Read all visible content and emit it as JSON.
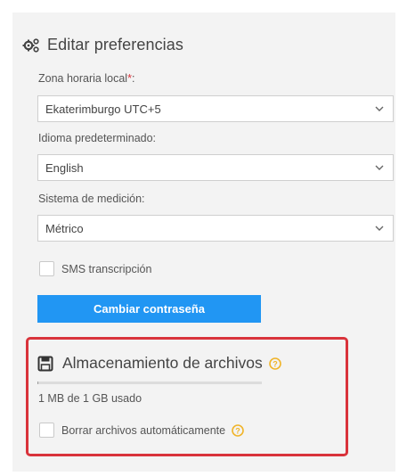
{
  "header": {
    "title": "Editar preferencias",
    "icon": "gears-icon"
  },
  "timezone": {
    "label": "Zona horaria local",
    "required_mark": "*",
    "label_suffix": ":",
    "value": "Ekaterimburgo UTC+5"
  },
  "language": {
    "label": "Idioma predeterminado:",
    "value": "English"
  },
  "measurement": {
    "label": "Sistema de medición:",
    "value": "Métrico"
  },
  "sms": {
    "label": "SMS transcripción",
    "checked": false
  },
  "change_password": {
    "label": "Cambiar contraseña"
  },
  "storage": {
    "title": "Almacenamiento de archivos",
    "icon": "save-icon",
    "usage_text": "1 MB de 1 GB usado",
    "usage_fraction": 0.001,
    "auto_delete_label": "Borrar archivos automáticamente",
    "auto_delete_checked": false
  },
  "colors": {
    "accent": "#2196f3",
    "highlight": "#d9333b",
    "help": "#f0b429"
  }
}
